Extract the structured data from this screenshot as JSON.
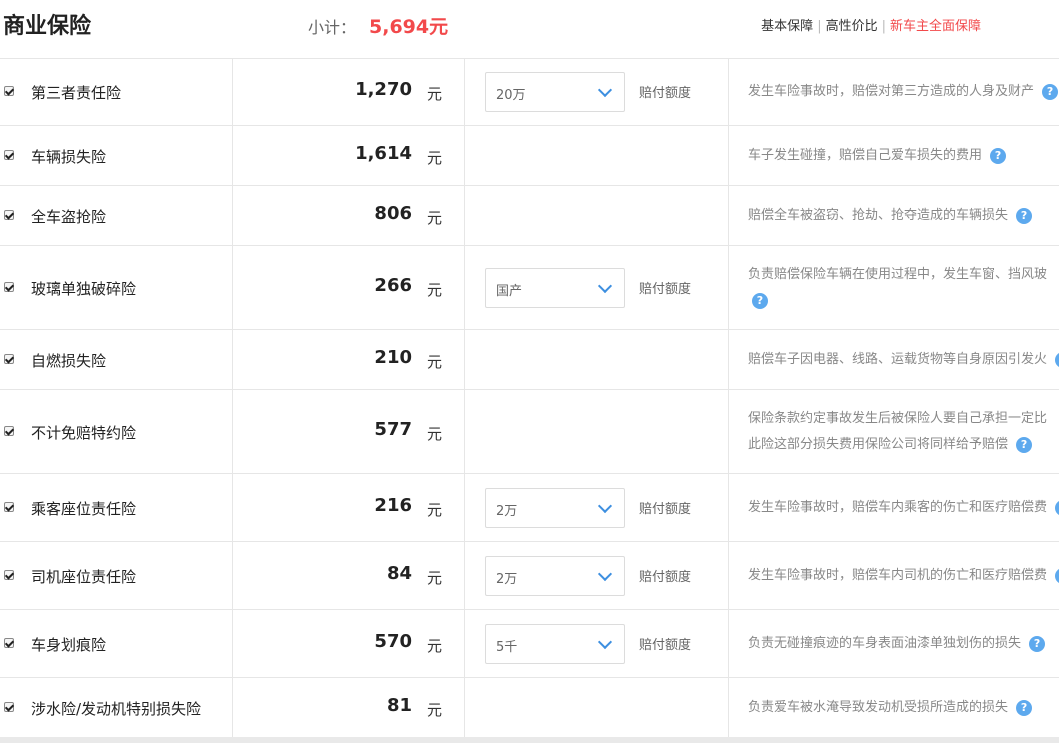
{
  "header": {
    "title": "商业保险",
    "subtotal_label": "小计：",
    "subtotal_value": "5,694元",
    "plans": [
      "基本保障",
      "高性价比",
      "新车主全面保障"
    ]
  },
  "unit": "元",
  "amount_label": "赔付额度",
  "help_icon": "?",
  "rows": [
    {
      "name": "第三者责任险",
      "price": "1,270",
      "select": "20万",
      "desc": [
        "发生车险事故时，赔偿对第三方造成的人身及财产"
      ]
    },
    {
      "name": "车辆损失险",
      "price": "1,614",
      "select": null,
      "desc": [
        "车子发生碰撞，赔偿自己爱车损失的费用"
      ]
    },
    {
      "name": "全车盗抢险",
      "price": "806",
      "select": null,
      "desc": [
        "赔偿全车被盗窃、抢劫、抢夺造成的车辆损失"
      ]
    },
    {
      "name": "玻璃单独破碎险",
      "price": "266",
      "select": "国产",
      "desc": [
        "负责赔偿保险车辆在使用过程中，发生车窗、挡风玻"
      ]
    },
    {
      "name": "自燃损失险",
      "price": "210",
      "select": null,
      "desc": [
        "赔偿车子因电器、线路、运载货物等自身原因引发火"
      ]
    },
    {
      "name": "不计免赔特约险",
      "price": "577",
      "select": null,
      "desc": [
        "保险条款约定事故发生后被保险人要自己承担一定比",
        "此险这部分损失费用保险公司将同样给予赔偿"
      ]
    },
    {
      "name": "乘客座位责任险",
      "price": "216",
      "select": "2万",
      "desc": [
        "发生车险事故时，赔偿车内乘客的伤亡和医疗赔偿费"
      ]
    },
    {
      "name": "司机座位责任险",
      "price": "84",
      "select": "2万",
      "desc": [
        "发生车险事故时，赔偿车内司机的伤亡和医疗赔偿费"
      ]
    },
    {
      "name": "车身划痕险",
      "price": "570",
      "select": "5千",
      "desc": [
        "负责无碰撞痕迹的车身表面油漆单独划伤的损失"
      ]
    },
    {
      "name": "涉水险/发动机特别损失险",
      "price": "81",
      "select": null,
      "desc": [
        "负责爱车被水淹导致发动机受损所造成的损失"
      ]
    }
  ]
}
